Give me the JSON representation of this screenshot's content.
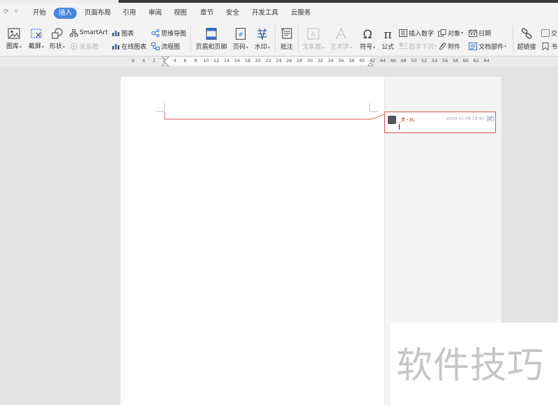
{
  "quick_access": {
    "redo_glyph": "⟳",
    "more_glyph": "▿"
  },
  "menu": {
    "tabs": [
      "开始",
      "插入",
      "页面布局",
      "引用",
      "审阅",
      "视图",
      "章节",
      "安全",
      "开发工具",
      "云服务"
    ],
    "active": "插入"
  },
  "ribbon": {
    "gallery": "图库",
    "screenshot": "截屏",
    "shapes": "形状",
    "smartart": "SmartArt",
    "relation": "关系图",
    "chart": "图表",
    "online_chart": "在线图表",
    "mindmap": "思维导图",
    "flowchart": "流程图",
    "header_footer": "页眉和页脚",
    "page_number": "页码",
    "watermark": "水印",
    "comment": "批注",
    "textbox": "文本框",
    "wordart": "艺术字",
    "symbol": "符号",
    "formula": "公式",
    "insert_number": "插入数字",
    "object": "对象",
    "date": "日期",
    "drop_cap": "首字下沉",
    "attachment": "附件",
    "doc_parts": "文档部件",
    "hyperlink": "超链接",
    "cross_ref_partial": "交",
    "bookmark_partial": "书"
  },
  "ruler": {
    "labels": [
      "6",
      "4",
      "2",
      "2",
      "4",
      "6",
      "8",
      "10",
      "12",
      "14",
      "16",
      "18",
      "20",
      "22",
      "24",
      "26",
      "28",
      "30",
      "32",
      "34",
      "36",
      "38",
      "40",
      "42",
      "44",
      "46",
      "48",
      "50",
      "52",
      "54",
      "56",
      "58",
      "60",
      "62",
      "64"
    ]
  },
  "comment": {
    "author": "_贵・秋。",
    "time": "2019-01-08 18:40"
  },
  "watermark_text": "软件技巧",
  "colors": {
    "accent": "#4a86e0",
    "comment_border": "#d9534f",
    "page": "#ffffff",
    "workspace": "#e3e3e3"
  }
}
